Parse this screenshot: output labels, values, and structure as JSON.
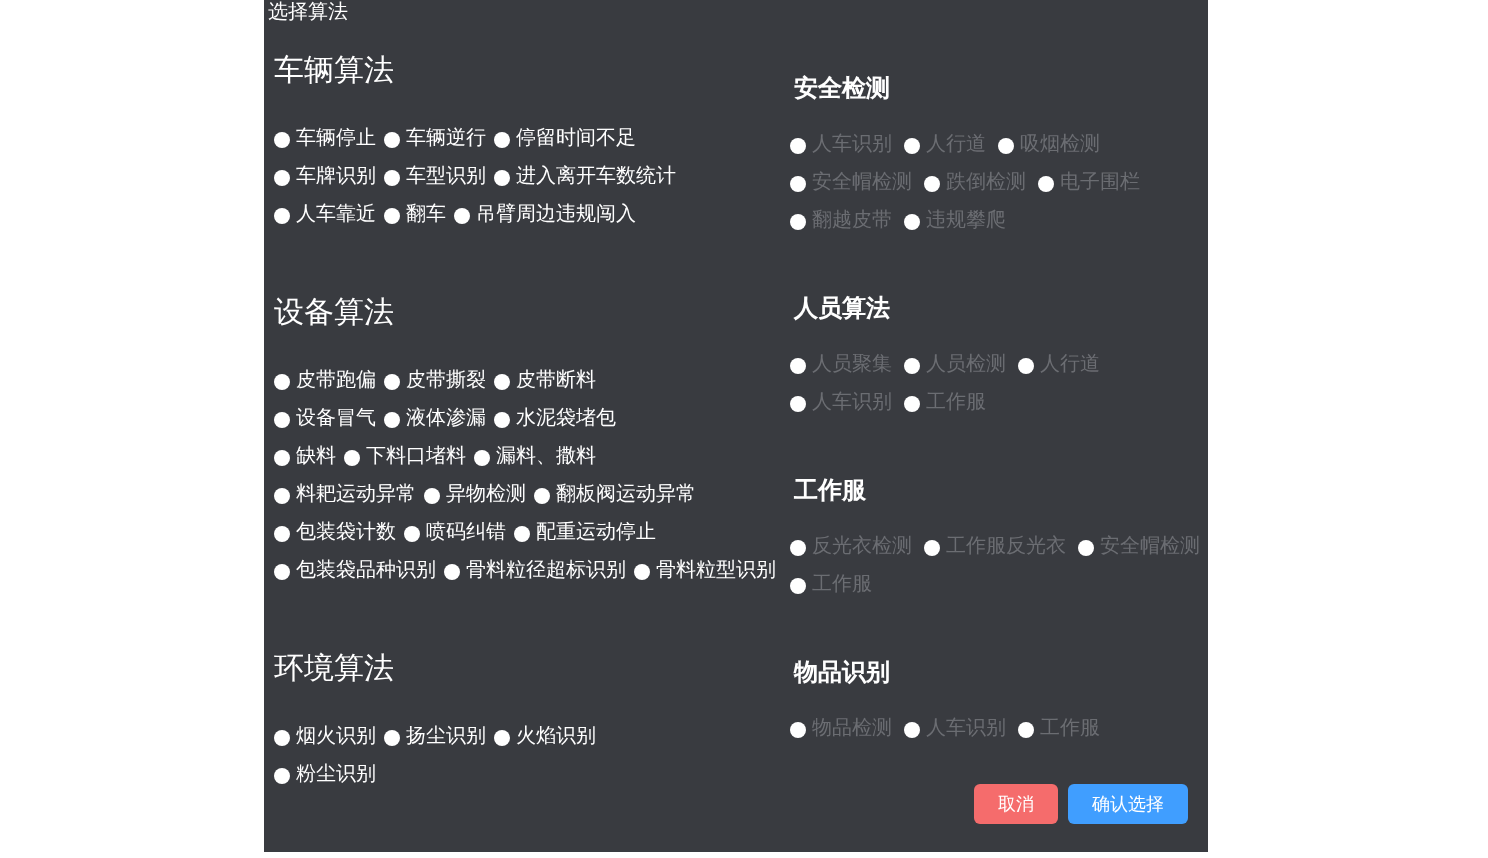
{
  "dialog": {
    "title": "选择算法"
  },
  "columns": [
    [
      {
        "title": "车辆算法",
        "kind": "main",
        "rows": [
          [
            "车辆停止",
            "车辆逆行",
            "停留时间不足"
          ],
          [
            "车牌识别",
            "车型识别",
            "进入离开车数统计"
          ],
          [
            "人车靠近",
            "翻车",
            "吊臂周边违规闯入"
          ]
        ],
        "disabled": false
      },
      {
        "title": "设备算法",
        "kind": "main",
        "rows": [
          [
            "皮带跑偏",
            "皮带撕裂",
            "皮带断料"
          ],
          [
            "设备冒气",
            "液体渗漏",
            "水泥袋堵包"
          ],
          [
            "缺料",
            "下料口堵料",
            "漏料、撒料"
          ],
          [
            "料耙运动异常",
            "异物检测",
            "翻板阀运动异常"
          ],
          [
            "包装袋计数",
            "喷码纠错",
            "配重运动停止"
          ],
          [
            "包装袋品种识别",
            "骨料粒径超标识别",
            "骨料粒型识别"
          ]
        ],
        "disabled": false
      },
      {
        "title": "环境算法",
        "kind": "main",
        "rows": [
          [
            "烟火识别",
            "扬尘识别",
            "火焰识别"
          ],
          [
            "粉尘识别"
          ]
        ],
        "disabled": false
      }
    ],
    [
      {
        "title": "安全检测",
        "kind": "sub",
        "rows": [
          [
            "人车识别",
            "人行道",
            "吸烟检测"
          ],
          [
            "安全帽检测",
            "跌倒检测",
            "电子围栏"
          ],
          [
            "翻越皮带",
            "违规攀爬"
          ]
        ],
        "disabled": true
      },
      {
        "title": "人员算法",
        "kind": "sub",
        "rows": [
          [
            "人员聚集",
            "人员检测",
            "人行道"
          ],
          [
            "人车识别",
            "工作服"
          ]
        ],
        "disabled": true
      },
      {
        "title": "工作服",
        "kind": "sub",
        "rows": [
          [
            "反光衣检测",
            "工作服反光衣",
            "安全帽检测"
          ],
          [
            "工作服"
          ]
        ],
        "disabled": true
      },
      {
        "title": "物品识别",
        "kind": "sub",
        "rows": [
          [
            "物品检测",
            "人车识别",
            "工作服"
          ]
        ],
        "disabled": true
      }
    ]
  ],
  "buttons": [
    {
      "label": "取消",
      "kind": "cancel"
    },
    {
      "label": "确认选择",
      "kind": "confirm"
    }
  ]
}
